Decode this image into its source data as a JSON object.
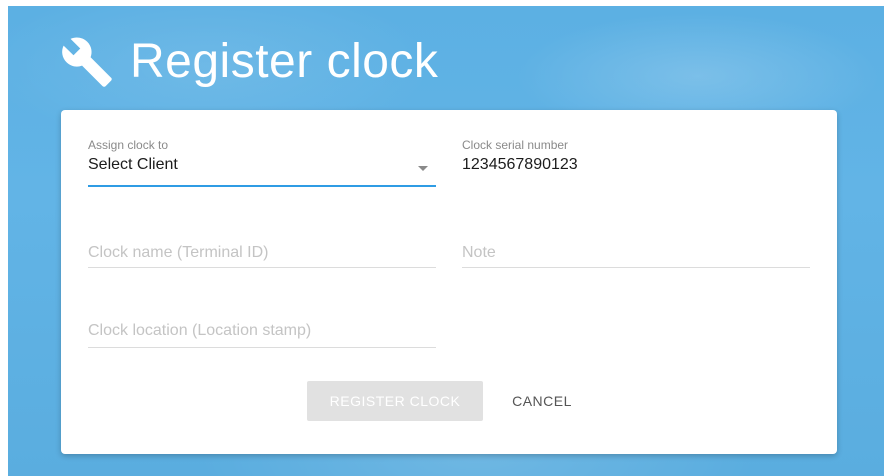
{
  "page": {
    "title": "Register clock",
    "header_icon": "wrench-icon",
    "background_color": "#5eb1e4",
    "accent_color": "#2f9ce4"
  },
  "form": {
    "assign_clock": {
      "label": "Assign clock to",
      "value": "Select Client"
    },
    "serial_number": {
      "label": "Clock serial number",
      "value": "1234567890123"
    },
    "clock_name": {
      "placeholder": "Clock name (Terminal ID)",
      "value": ""
    },
    "note": {
      "placeholder": "Note",
      "value": ""
    },
    "clock_location": {
      "placeholder": "Clock location (Location stamp)",
      "value": ""
    }
  },
  "actions": {
    "register_label": "REGISTER CLOCK",
    "register_disabled": true,
    "cancel_label": "CANCEL"
  }
}
